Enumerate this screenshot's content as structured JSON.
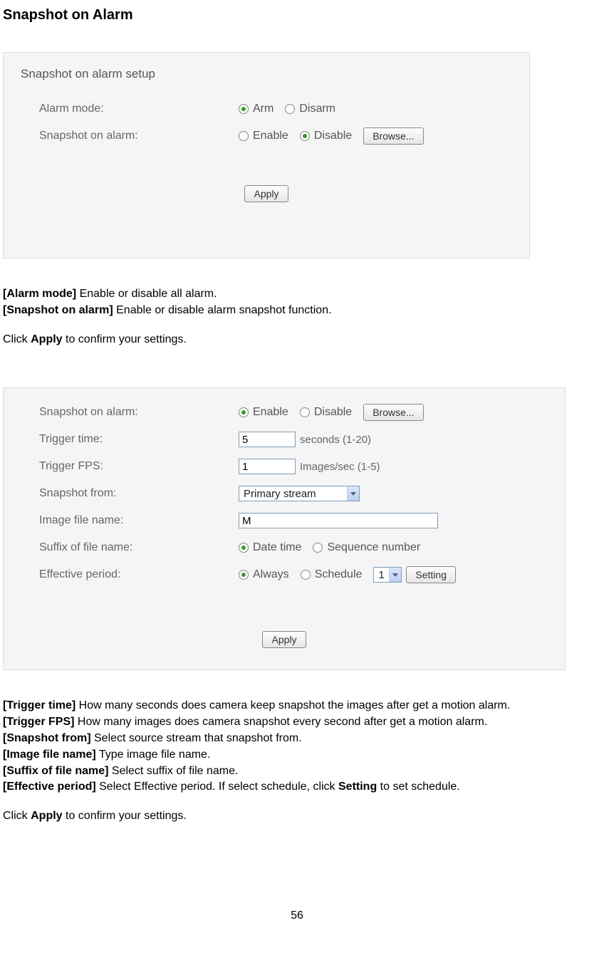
{
  "page": {
    "title": "Snapshot on Alarm",
    "pageNumber": "56"
  },
  "panel1": {
    "title": "Snapshot on alarm setup",
    "alarmMode": {
      "label": "Alarm mode:",
      "arm": "Arm",
      "disarm": "Disarm",
      "selected": "arm"
    },
    "snapshotOnAlarm": {
      "label": "Snapshot on alarm:",
      "enable": "Enable",
      "disable": "Disable",
      "selected": "disable",
      "browse": "Browse..."
    },
    "apply": "Apply"
  },
  "desc1": {
    "line1_bold": "[Alarm mode]",
    "line1_rest": " Enable or disable all alarm.",
    "line2_bold": "[Snapshot on alarm]",
    "line2_rest": " Enable or disable alarm snapshot function.",
    "click_text": "Click ",
    "apply_bold": "Apply",
    "click_rest": " to confirm your settings."
  },
  "panel2": {
    "snapshotOnAlarm": {
      "label": "Snapshot on alarm:",
      "enable": "Enable",
      "disable": "Disable",
      "selected": "enable",
      "browse": "Browse..."
    },
    "triggerTime": {
      "label": "Trigger time:",
      "value": "5",
      "hint": "seconds (1-20)"
    },
    "triggerFps": {
      "label": "Trigger FPS:",
      "value": "1",
      "hint": "Images/sec (1-5)"
    },
    "snapshotFrom": {
      "label": "Snapshot from:",
      "selected": "Primary stream"
    },
    "imageFileName": {
      "label": "Image file name:",
      "value": "M"
    },
    "suffix": {
      "label": "Suffix of file name:",
      "dateTime": "Date time",
      "seq": "Sequence number",
      "selected": "dateTime"
    },
    "effective": {
      "label": "Effective period:",
      "always": "Always",
      "schedule": "Schedule",
      "selected": "always",
      "selectVal": "1",
      "settingBtn": "Setting"
    },
    "apply": "Apply"
  },
  "desc2": {
    "l1b": "[Trigger time]",
    "l1r": " How many seconds does camera keep snapshot the images after get a motion alarm.",
    "l2b": "[Trigger FPS]",
    "l2r": " How many images does camera snapshot every second after get a motion alarm.",
    "l3b": "[Snapshot from]",
    "l3r": " Select source stream that snapshot from.",
    "l4b": "[Image file name]",
    "l4r": " Type image file name.",
    "l5b": "[Suffix of file name]",
    "l5r": " Select suffix of file name.",
    "l6b": "[Effective period]",
    "l6r1": " Select Effective period. If select schedule, click ",
    "l6bold2": "Setting",
    "l6r2": " to set schedule.",
    "click_text": "Click ",
    "apply_bold": "Apply",
    "click_rest": " to confirm your settings."
  }
}
